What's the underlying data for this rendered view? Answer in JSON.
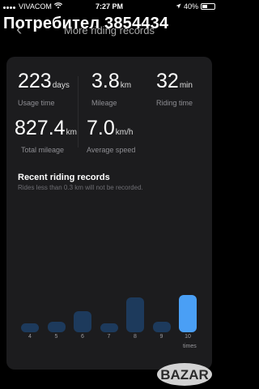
{
  "status_bar": {
    "carrier": "VIVACOM",
    "time": "7:27 PM",
    "battery": "40%"
  },
  "watermark": "Потребител 3854434",
  "header": {
    "title": "More riding records"
  },
  "stats": {
    "days": {
      "value": "223",
      "unit": "days",
      "label": "Usage time"
    },
    "mileage": {
      "value": "3.8",
      "unit": "km",
      "label": "Mileage"
    },
    "riding_time": {
      "value": "32",
      "unit": "min",
      "label": "Riding time"
    },
    "total_mileage": {
      "value": "827.4",
      "unit": "km",
      "label": "Total mileage"
    },
    "avg_speed": {
      "value": "7.0",
      "unit": "km/h",
      "label": "Average speed"
    }
  },
  "records": {
    "title": "Recent riding records",
    "subtitle": "Rides less than 0.3 km will not be recorded.",
    "x_unit": "times",
    "bars": [
      {
        "label": "4",
        "level": 0.22
      },
      {
        "label": "5",
        "level": 0.28
      },
      {
        "label": "6",
        "level": 0.55
      },
      {
        "label": "7",
        "level": 0.22
      },
      {
        "label": "8",
        "level": 0.9
      },
      {
        "label": "9",
        "level": 0.28
      },
      {
        "label": "10",
        "level": 0.95,
        "active": true
      }
    ]
  },
  "logo_text": "BAZAR"
}
